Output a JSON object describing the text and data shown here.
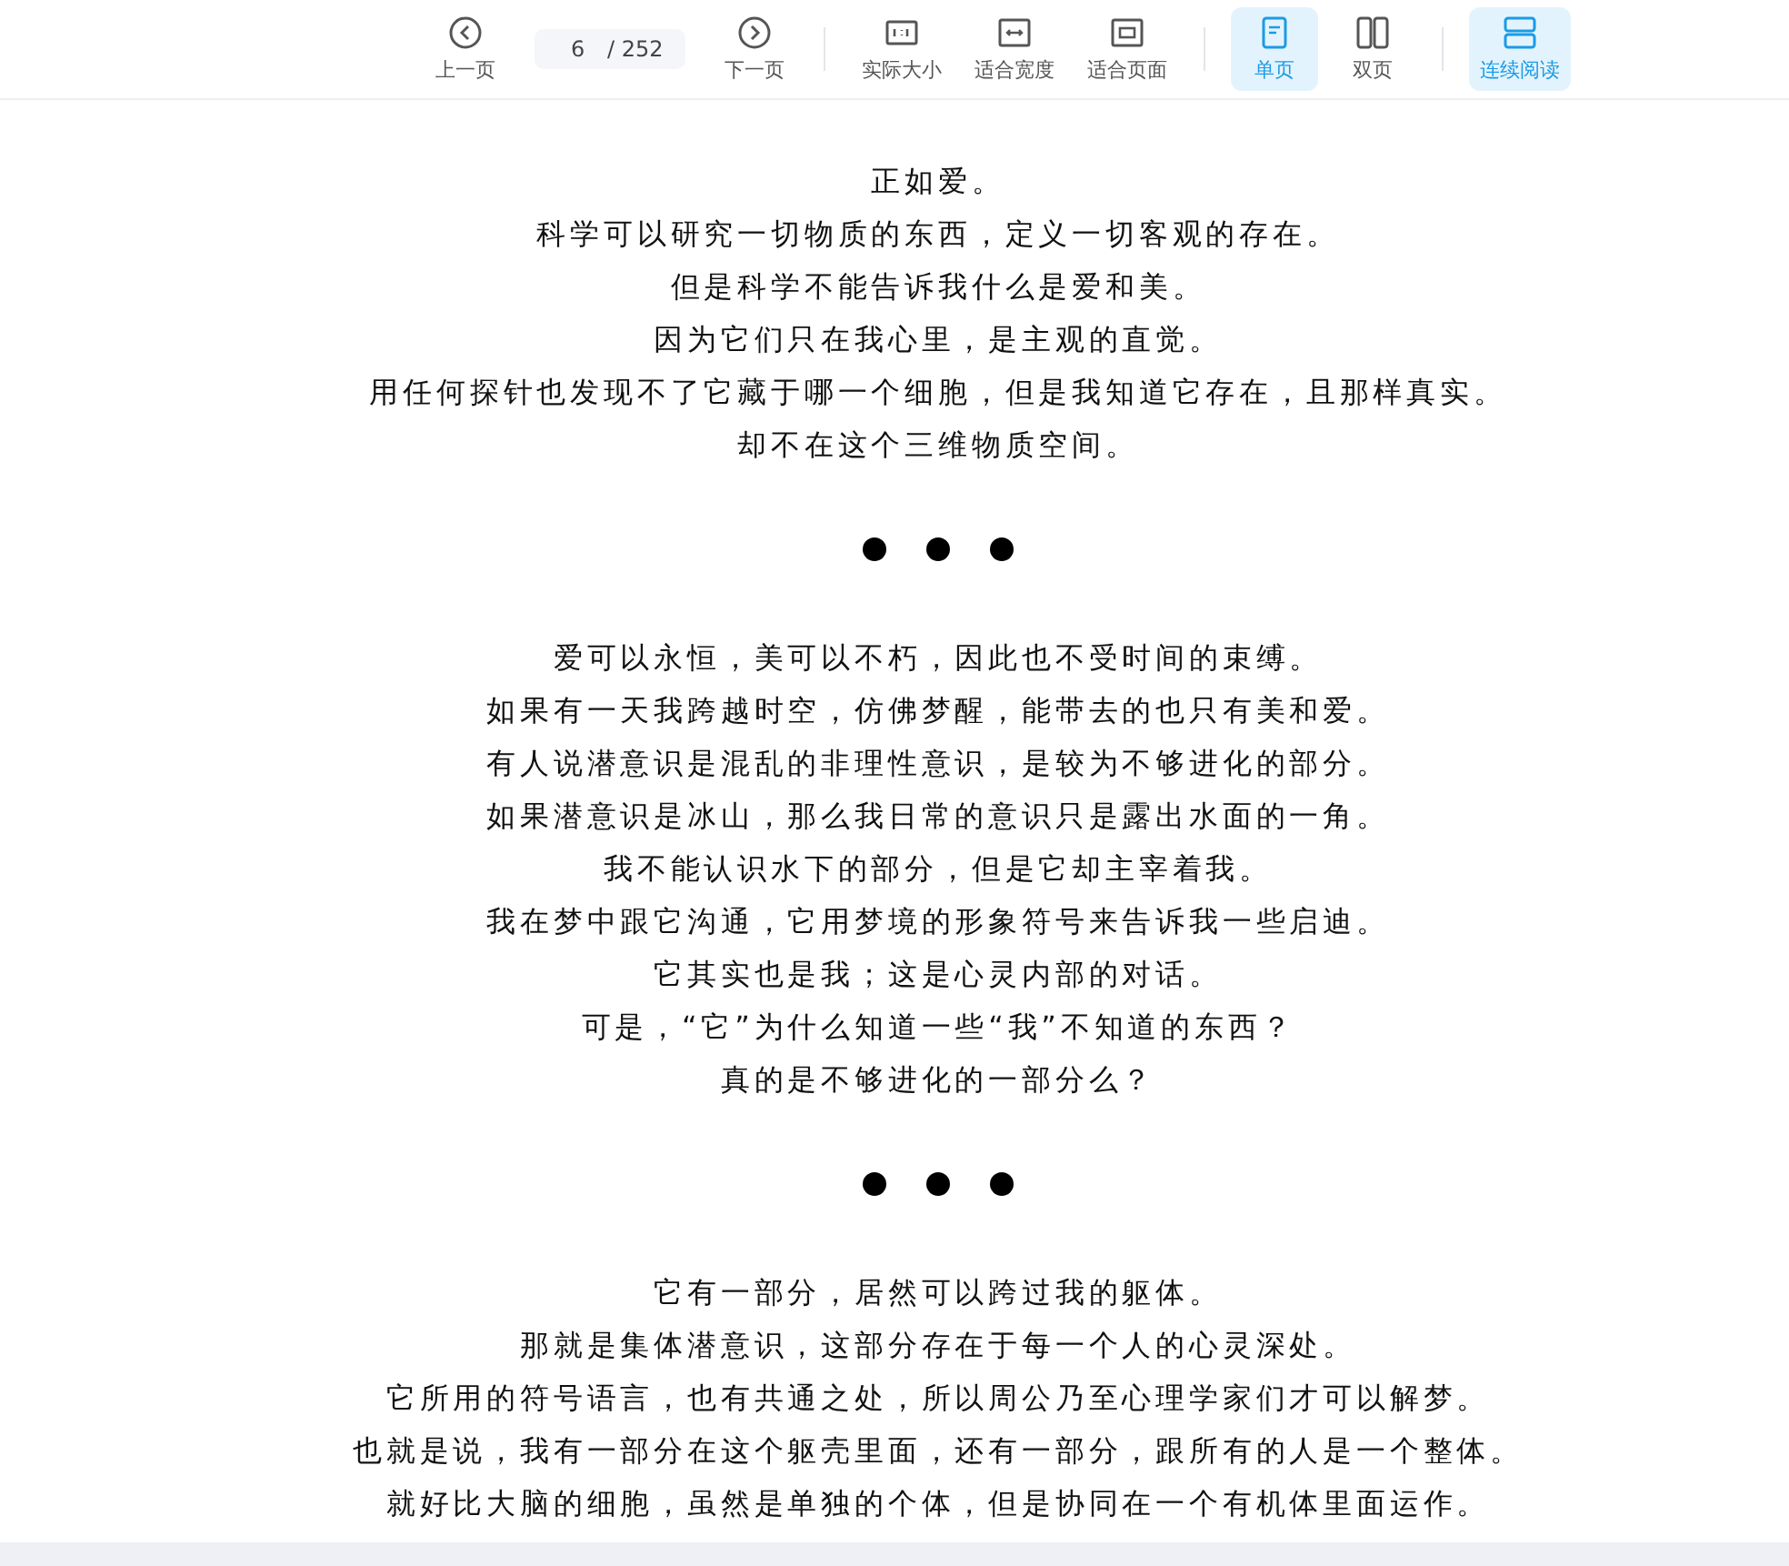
{
  "toolbar": {
    "items": [
      {
        "kind": "prev",
        "label": "上一页",
        "selected": false
      },
      {
        "kind": "page",
        "value": "6",
        "total": "/ 252"
      },
      {
        "kind": "next",
        "label": "下一页",
        "selected": false
      },
      {
        "kind": "divider"
      },
      {
        "kind": "actual",
        "label": "实际大小",
        "selected": false
      },
      {
        "kind": "fitwidth",
        "label": "适合宽度",
        "selected": false
      },
      {
        "kind": "fitpage",
        "label": "适合页面",
        "selected": false
      },
      {
        "kind": "divider"
      },
      {
        "kind": "single",
        "label": "单页",
        "selected": true
      },
      {
        "kind": "double",
        "label": "双页",
        "selected": false
      },
      {
        "kind": "divider"
      },
      {
        "kind": "continuous",
        "label": "连续阅读",
        "selected": true
      }
    ]
  },
  "document": {
    "blocks": [
      {
        "kind": "text",
        "lines": [
          "正如爱。",
          "科学可以研究一切物质的东西，定义一切客观的存在。",
          "但是科学不能告诉我什么是爱和美。",
          "因为它们只在我心里，是主观的直觉。",
          "用任何探针也发现不了它藏于哪一个细胞，但是我知道它存在，且那样真实。",
          "却不在这个三维物质空间。"
        ]
      },
      {
        "kind": "dots"
      },
      {
        "kind": "text",
        "lines": [
          "爱可以永恒，美可以不朽，因此也不受时间的束缚。",
          "如果有一天我跨越时空，仿佛梦醒，能带去的也只有美和爱。",
          "有人说潜意识是混乱的非理性意识，是较为不够进化的部分。",
          "如果潜意识是冰山，那么我日常的意识只是露出水面的一角。",
          "我不能认识水下的部分，但是它却主宰着我。",
          "我在梦中跟它沟通，它用梦境的形象符号来告诉我一些启迪。",
          "它其实也是我；这是心灵内部的对话。",
          "可是，“它”为什么知道一些“我”不知道的东西？",
          "真的是不够进化的一部分么？"
        ]
      },
      {
        "kind": "dots"
      },
      {
        "kind": "text",
        "lines": [
          "它有一部分，居然可以跨过我的躯体。",
          "那就是集体潜意识，这部分存在于每一个人的心灵深处。",
          "它所用的符号语言，也有共通之处，所以周公乃至心理学家们才可以解梦。",
          "也就是说，我有一部分在这个躯壳里面，还有一部分，跟所有的人是一个整体。",
          "就好比大脑的细胞，虽然是单独的个体，但是协同在一个有机体里面运作。"
        ]
      }
    ]
  }
}
